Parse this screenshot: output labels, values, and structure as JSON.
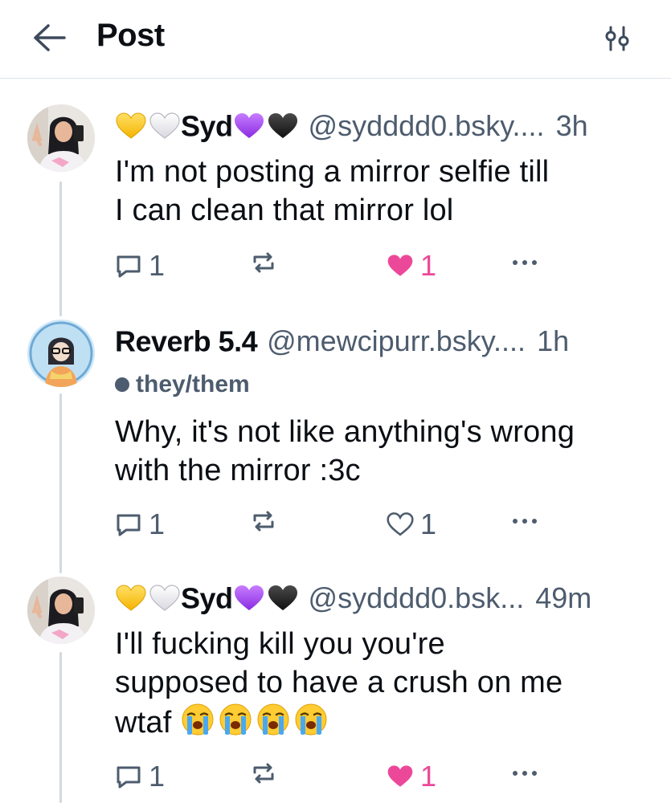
{
  "header": {
    "title": "Post",
    "back_icon": "arrow-left-icon",
    "filter_icon": "sliders-icon"
  },
  "colors": {
    "accent": "#ec4899",
    "muted": "#4d5c6e",
    "thread_line": "#d3d9e0",
    "divider": "#dfe3e8"
  },
  "posts": [
    {
      "author_hearts_before": [
        "yellow-heart",
        "white-heart"
      ],
      "author_name": "Syd",
      "author_hearts_after": [
        "purple-heart",
        "black-heart"
      ],
      "handle": "@sydddd0.bsky....",
      "time": "3h",
      "pronouns": "",
      "text_lines": [
        "I'm not posting a mirror selfie till",
        "I can clean that mirror lol"
      ],
      "emoji_count": 0,
      "reply_count": "1",
      "repost_count": "",
      "like_count": "1",
      "liked": true
    },
    {
      "author_hearts_before": [],
      "author_name": "Reverb 5.4",
      "author_hearts_after": [],
      "handle": "@mewcipurr.bsky....",
      "time": "1h",
      "pronouns": "they/them",
      "text_lines": [
        "Why, it's not like anything's wrong",
        "with the mirror :3c"
      ],
      "emoji_count": 0,
      "reply_count": "1",
      "repost_count": "",
      "like_count": "1",
      "liked": false
    },
    {
      "author_hearts_before": [
        "yellow-heart",
        "white-heart"
      ],
      "author_name": "Syd",
      "author_hearts_after": [
        "purple-heart",
        "black-heart"
      ],
      "handle": "@sydddd0.bsk...",
      "time": "49m",
      "pronouns": "",
      "text_lines": [
        "I'll fucking kill you you're",
        "supposed to have a crush on me",
        "wtaf"
      ],
      "emoji_count": 4,
      "emoji_name": "loudly-crying-face",
      "reply_count": "1",
      "repost_count": "",
      "like_count": "1",
      "liked": true
    }
  ]
}
